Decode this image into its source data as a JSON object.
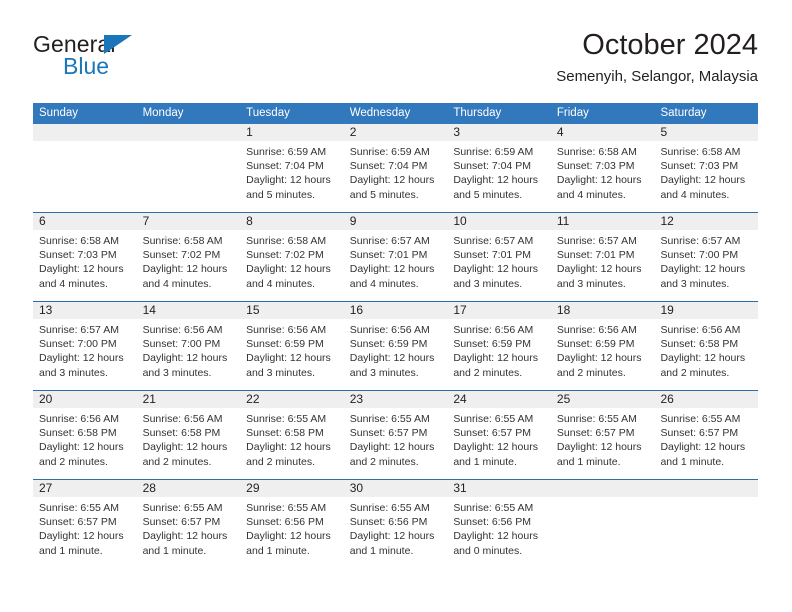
{
  "brand": {
    "name_part1": "General",
    "name_part2": "Blue",
    "color_dark": "#231f20",
    "color_blue": "#1b75bb"
  },
  "header": {
    "title": "October 2024",
    "subtitle": "Semenyih, Selangor, Malaysia"
  },
  "theme": {
    "header_bg": "#3278bc",
    "header_text": "#ffffff",
    "week_divider": "#2e6da8",
    "daynum_band": "#efefef",
    "body_text": "#333333"
  },
  "weekdays": [
    "Sunday",
    "Monday",
    "Tuesday",
    "Wednesday",
    "Thursday",
    "Friday",
    "Saturday"
  ],
  "weeks": [
    [
      {
        "day": "",
        "sunrise": "",
        "sunset": "",
        "daylight": "",
        "empty": true
      },
      {
        "day": "",
        "sunrise": "",
        "sunset": "",
        "daylight": "",
        "empty": true
      },
      {
        "day": "1",
        "sunrise": "Sunrise: 6:59 AM",
        "sunset": "Sunset: 7:04 PM",
        "daylight": "Daylight: 12 hours and 5 minutes."
      },
      {
        "day": "2",
        "sunrise": "Sunrise: 6:59 AM",
        "sunset": "Sunset: 7:04 PM",
        "daylight": "Daylight: 12 hours and 5 minutes."
      },
      {
        "day": "3",
        "sunrise": "Sunrise: 6:59 AM",
        "sunset": "Sunset: 7:04 PM",
        "daylight": "Daylight: 12 hours and 5 minutes."
      },
      {
        "day": "4",
        "sunrise": "Sunrise: 6:58 AM",
        "sunset": "Sunset: 7:03 PM",
        "daylight": "Daylight: 12 hours and 4 minutes."
      },
      {
        "day": "5",
        "sunrise": "Sunrise: 6:58 AM",
        "sunset": "Sunset: 7:03 PM",
        "daylight": "Daylight: 12 hours and 4 minutes."
      }
    ],
    [
      {
        "day": "6",
        "sunrise": "Sunrise: 6:58 AM",
        "sunset": "Sunset: 7:03 PM",
        "daylight": "Daylight: 12 hours and 4 minutes."
      },
      {
        "day": "7",
        "sunrise": "Sunrise: 6:58 AM",
        "sunset": "Sunset: 7:02 PM",
        "daylight": "Daylight: 12 hours and 4 minutes."
      },
      {
        "day": "8",
        "sunrise": "Sunrise: 6:58 AM",
        "sunset": "Sunset: 7:02 PM",
        "daylight": "Daylight: 12 hours and 4 minutes."
      },
      {
        "day": "9",
        "sunrise": "Sunrise: 6:57 AM",
        "sunset": "Sunset: 7:01 PM",
        "daylight": "Daylight: 12 hours and 4 minutes."
      },
      {
        "day": "10",
        "sunrise": "Sunrise: 6:57 AM",
        "sunset": "Sunset: 7:01 PM",
        "daylight": "Daylight: 12 hours and 3 minutes."
      },
      {
        "day": "11",
        "sunrise": "Sunrise: 6:57 AM",
        "sunset": "Sunset: 7:01 PM",
        "daylight": "Daylight: 12 hours and 3 minutes."
      },
      {
        "day": "12",
        "sunrise": "Sunrise: 6:57 AM",
        "sunset": "Sunset: 7:00 PM",
        "daylight": "Daylight: 12 hours and 3 minutes."
      }
    ],
    [
      {
        "day": "13",
        "sunrise": "Sunrise: 6:57 AM",
        "sunset": "Sunset: 7:00 PM",
        "daylight": "Daylight: 12 hours and 3 minutes."
      },
      {
        "day": "14",
        "sunrise": "Sunrise: 6:56 AM",
        "sunset": "Sunset: 7:00 PM",
        "daylight": "Daylight: 12 hours and 3 minutes."
      },
      {
        "day": "15",
        "sunrise": "Sunrise: 6:56 AM",
        "sunset": "Sunset: 6:59 PM",
        "daylight": "Daylight: 12 hours and 3 minutes."
      },
      {
        "day": "16",
        "sunrise": "Sunrise: 6:56 AM",
        "sunset": "Sunset: 6:59 PM",
        "daylight": "Daylight: 12 hours and 3 minutes."
      },
      {
        "day": "17",
        "sunrise": "Sunrise: 6:56 AM",
        "sunset": "Sunset: 6:59 PM",
        "daylight": "Daylight: 12 hours and 2 minutes."
      },
      {
        "day": "18",
        "sunrise": "Sunrise: 6:56 AM",
        "sunset": "Sunset: 6:59 PM",
        "daylight": "Daylight: 12 hours and 2 minutes."
      },
      {
        "day": "19",
        "sunrise": "Sunrise: 6:56 AM",
        "sunset": "Sunset: 6:58 PM",
        "daylight": "Daylight: 12 hours and 2 minutes."
      }
    ],
    [
      {
        "day": "20",
        "sunrise": "Sunrise: 6:56 AM",
        "sunset": "Sunset: 6:58 PM",
        "daylight": "Daylight: 12 hours and 2 minutes."
      },
      {
        "day": "21",
        "sunrise": "Sunrise: 6:56 AM",
        "sunset": "Sunset: 6:58 PM",
        "daylight": "Daylight: 12 hours and 2 minutes."
      },
      {
        "day": "22",
        "sunrise": "Sunrise: 6:55 AM",
        "sunset": "Sunset: 6:58 PM",
        "daylight": "Daylight: 12 hours and 2 minutes."
      },
      {
        "day": "23",
        "sunrise": "Sunrise: 6:55 AM",
        "sunset": "Sunset: 6:57 PM",
        "daylight": "Daylight: 12 hours and 2 minutes."
      },
      {
        "day": "24",
        "sunrise": "Sunrise: 6:55 AM",
        "sunset": "Sunset: 6:57 PM",
        "daylight": "Daylight: 12 hours and 1 minute."
      },
      {
        "day": "25",
        "sunrise": "Sunrise: 6:55 AM",
        "sunset": "Sunset: 6:57 PM",
        "daylight": "Daylight: 12 hours and 1 minute."
      },
      {
        "day": "26",
        "sunrise": "Sunrise: 6:55 AM",
        "sunset": "Sunset: 6:57 PM",
        "daylight": "Daylight: 12 hours and 1 minute."
      }
    ],
    [
      {
        "day": "27",
        "sunrise": "Sunrise: 6:55 AM",
        "sunset": "Sunset: 6:57 PM",
        "daylight": "Daylight: 12 hours and 1 minute."
      },
      {
        "day": "28",
        "sunrise": "Sunrise: 6:55 AM",
        "sunset": "Sunset: 6:57 PM",
        "daylight": "Daylight: 12 hours and 1 minute."
      },
      {
        "day": "29",
        "sunrise": "Sunrise: 6:55 AM",
        "sunset": "Sunset: 6:56 PM",
        "daylight": "Daylight: 12 hours and 1 minute."
      },
      {
        "day": "30",
        "sunrise": "Sunrise: 6:55 AM",
        "sunset": "Sunset: 6:56 PM",
        "daylight": "Daylight: 12 hours and 1 minute."
      },
      {
        "day": "31",
        "sunrise": "Sunrise: 6:55 AM",
        "sunset": "Sunset: 6:56 PM",
        "daylight": "Daylight: 12 hours and 0 minutes."
      },
      {
        "day": "",
        "sunrise": "",
        "sunset": "",
        "daylight": "",
        "empty": true
      },
      {
        "day": "",
        "sunrise": "",
        "sunset": "",
        "daylight": "",
        "empty": true
      }
    ]
  ]
}
